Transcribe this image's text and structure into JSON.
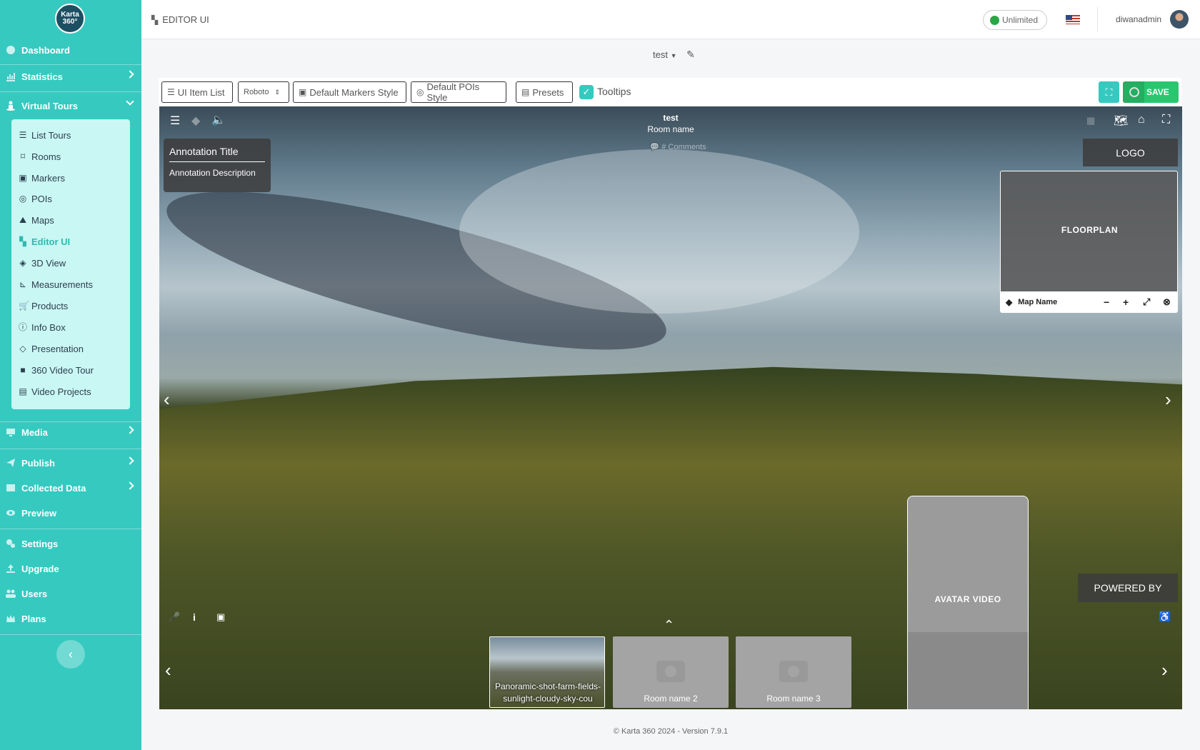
{
  "sidebar": {
    "logo_line1": "Karta",
    "logo_line2": "360°",
    "items": [
      {
        "label": "Dashboard"
      },
      {
        "label": "Statistics"
      },
      {
        "label": "Virtual Tours"
      },
      {
        "label": "Media"
      },
      {
        "label": "Publish"
      },
      {
        "label": "Collected Data"
      },
      {
        "label": "Preview"
      },
      {
        "label": "Settings"
      },
      {
        "label": "Upgrade"
      },
      {
        "label": "Users"
      },
      {
        "label": "Plans"
      }
    ],
    "sub_items": [
      {
        "label": "List Tours"
      },
      {
        "label": "Rooms"
      },
      {
        "label": "Markers"
      },
      {
        "label": "POIs"
      },
      {
        "label": "Maps"
      },
      {
        "label": "Editor UI"
      },
      {
        "label": "3D View"
      },
      {
        "label": "Measurements"
      },
      {
        "label": "Products"
      },
      {
        "label": "Info Box"
      },
      {
        "label": "Presentation"
      },
      {
        "label": "360 Video Tour"
      },
      {
        "label": "Video Projects"
      }
    ]
  },
  "header": {
    "page_title": "EDITOR UI",
    "plan_badge": "Unlimited",
    "username": "diwanadmin"
  },
  "tour": {
    "name": "test"
  },
  "toolbar": {
    "ui_item_list": "UI Item List",
    "font": "Roboto",
    "default_markers_style": "Default Markers Style",
    "default_pois_style": "Default POIs Style",
    "presets": "Presets",
    "tooltips": "Tooltips",
    "save": "SAVE"
  },
  "viewer": {
    "tour_title": "test",
    "room_name": "Room name",
    "comments": "# Comments",
    "annotation_title": "Annotation Title",
    "annotation_description": "Annotation Description",
    "logo": "LOGO",
    "floorplan": "FLOORPLAN",
    "map_name": "Map Name",
    "avatar_video": "AVATAR VIDEO",
    "powered_by": "POWERED BY",
    "thumbnails": [
      {
        "label": "Panoramic-shot-farm-fields-sunlight-cloudy-sky-cou"
      },
      {
        "label": "Room name 2"
      },
      {
        "label": "Room name 3"
      }
    ]
  },
  "footer": {
    "text": "© Karta 360 2024 - Version 7.9.1"
  },
  "colors": {
    "sidebar": "#36c9c0",
    "save": "#28c76f",
    "active_sub": "#2fb9af"
  }
}
